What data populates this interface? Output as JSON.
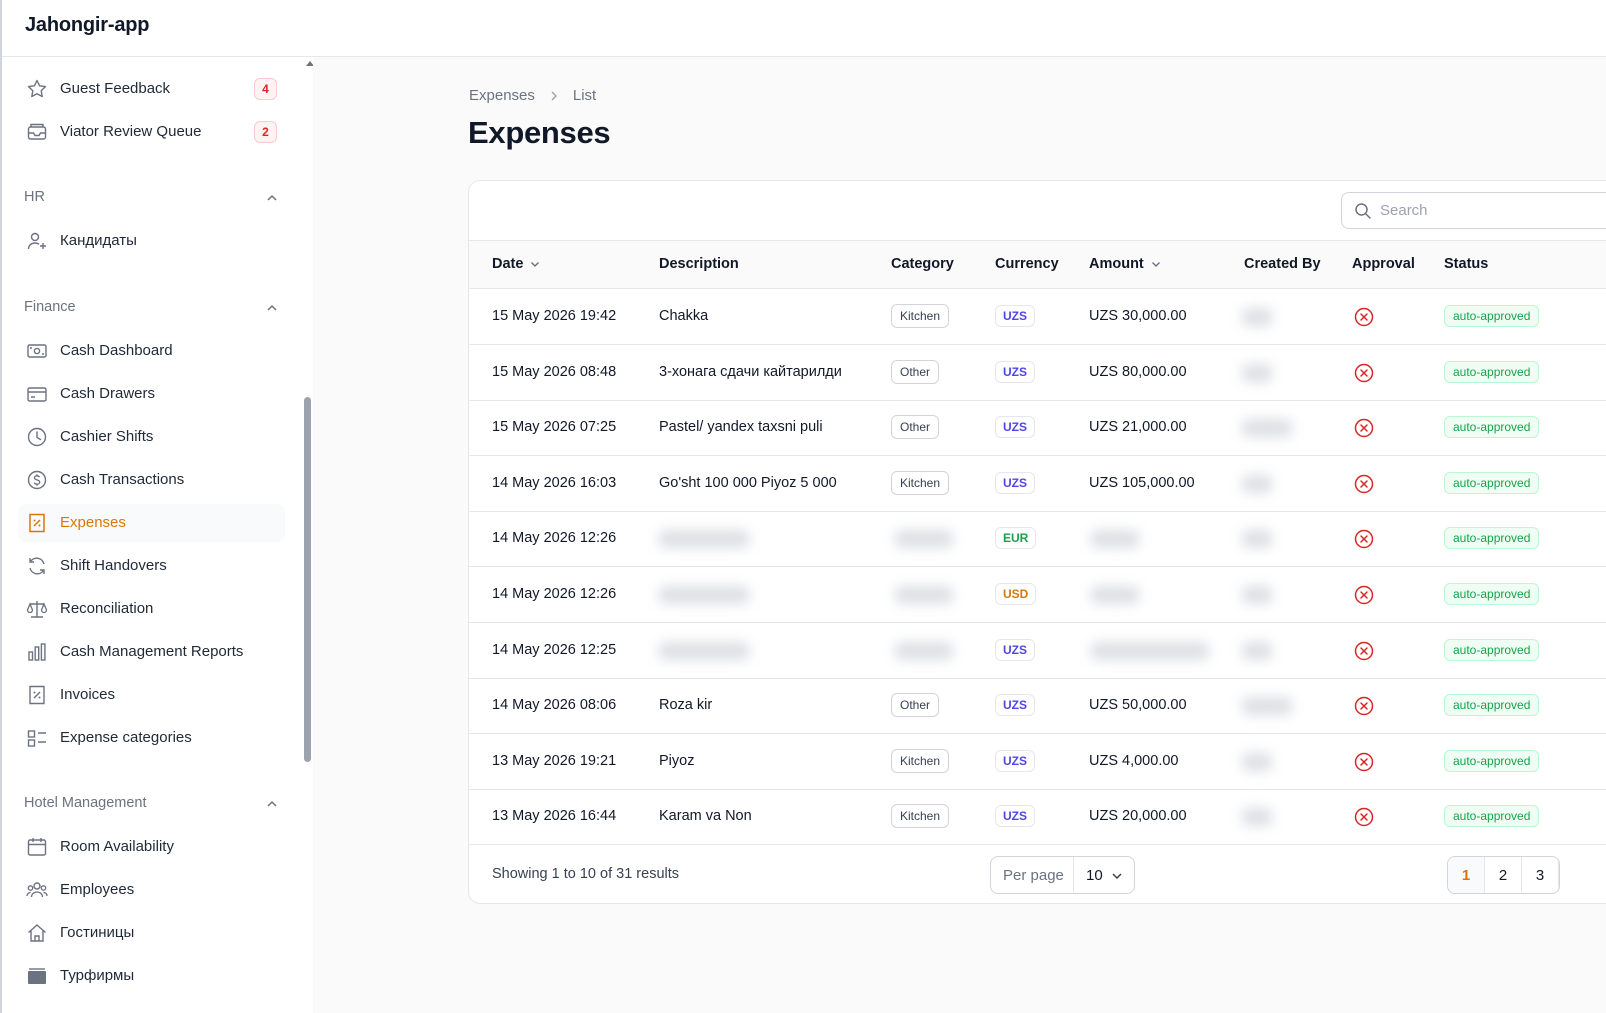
{
  "app": {
    "title": "Jahongir-app"
  },
  "sidebar": {
    "items_top": [
      {
        "label": "Guest Feedback",
        "icon": "star-icon",
        "badge": "4"
      },
      {
        "label": "Viator Review Queue",
        "icon": "inbox-icon",
        "badge": "2"
      }
    ],
    "groups": [
      {
        "label": "HR",
        "items": [
          {
            "label": "Кандидаты",
            "icon": "user-plus-icon"
          }
        ]
      },
      {
        "label": "Finance",
        "items": [
          {
            "label": "Cash Dashboard",
            "icon": "banknote-icon"
          },
          {
            "label": "Cash Drawers",
            "icon": "credit-card-icon"
          },
          {
            "label": "Cashier Shifts",
            "icon": "clock-icon"
          },
          {
            "label": "Cash Transactions",
            "icon": "dollar-circle-icon"
          },
          {
            "label": "Expenses",
            "icon": "receipt-percent-icon",
            "active": true
          },
          {
            "label": "Shift Handovers",
            "icon": "refresh-icon"
          },
          {
            "label": "Reconciliation",
            "icon": "scale-icon"
          },
          {
            "label": "Cash Management Reports",
            "icon": "bar-chart-icon"
          },
          {
            "label": "Invoices",
            "icon": "receipt-icon"
          },
          {
            "label": "Expense categories",
            "icon": "category-icon"
          }
        ]
      },
      {
        "label": "Hotel Management",
        "items": [
          {
            "label": "Room Availability",
            "icon": "calendar-icon"
          },
          {
            "label": "Employees",
            "icon": "users-icon"
          },
          {
            "label": "Гостиницы",
            "icon": "home-icon"
          },
          {
            "label": "Турфирмы",
            "icon": "folder-icon"
          }
        ]
      }
    ]
  },
  "breadcrumb": {
    "parent": "Expenses",
    "current": "List"
  },
  "page": {
    "title": "Expenses"
  },
  "search": {
    "placeholder": "Search"
  },
  "table": {
    "columns": [
      "Date",
      "Description",
      "Category",
      "Currency",
      "Amount",
      "Created By",
      "Approval",
      "Status"
    ],
    "rows": [
      {
        "date": "15 May 2026 19:42",
        "description": "Chakka",
        "category": "Kitchen",
        "currency": "UZS",
        "amount": "UZS 30,000.00",
        "status": "auto-approved"
      },
      {
        "date": "15 May 2026 08:48",
        "description": "3-хонага сдачи кайтарилди",
        "category": "Other",
        "currency": "UZS",
        "amount": "UZS 80,000.00",
        "status": "auto-approved"
      },
      {
        "date": "15 May 2026 07:25",
        "description": "Pastel/ yandex taxsni puli",
        "category": "Other",
        "currency": "UZS",
        "amount": "UZS 21,000.00",
        "status": "auto-approved"
      },
      {
        "date": "14 May 2026 16:03",
        "description": "Go'sht 100 000 Piyoz 5 000",
        "category": "Kitchen",
        "currency": "UZS",
        "amount": "UZS 105,000.00",
        "status": "auto-approved"
      },
      {
        "date": "14 May 2026 12:26",
        "description": null,
        "category": null,
        "currency": "EUR",
        "amount": null,
        "status": "auto-approved"
      },
      {
        "date": "14 May 2026 12:26",
        "description": null,
        "category": null,
        "currency": "USD",
        "amount": null,
        "status": "auto-approved"
      },
      {
        "date": "14 May 2026 12:25",
        "description": null,
        "category": null,
        "currency": "UZS",
        "amount": null,
        "status": "auto-approved"
      },
      {
        "date": "14 May 2026 08:06",
        "description": "Roza kir",
        "category": "Other",
        "currency": "UZS",
        "amount": "UZS 50,000.00",
        "status": "auto-approved"
      },
      {
        "date": "13 May 2026 19:21",
        "description": "Piyoz",
        "category": "Kitchen",
        "currency": "UZS",
        "amount": "UZS 4,000.00",
        "status": "auto-approved"
      },
      {
        "date": "13 May 2026 16:44",
        "description": "Karam va Non",
        "category": "Kitchen",
        "currency": "UZS",
        "amount": "UZS 20,000.00",
        "status": "auto-approved"
      }
    ]
  },
  "footer": {
    "summary": "Showing 1 to 10 of 31 results",
    "per_page_label": "Per page",
    "per_page_value": "10"
  },
  "pagination": {
    "pages": [
      "1",
      "2",
      "3"
    ],
    "current": "1"
  },
  "colors": {
    "accent": "#d97706",
    "success": "#16a34a",
    "danger": "#dc2626",
    "uzs": "#4f46e5",
    "eur": "#16a34a",
    "usd": "#d97706"
  }
}
